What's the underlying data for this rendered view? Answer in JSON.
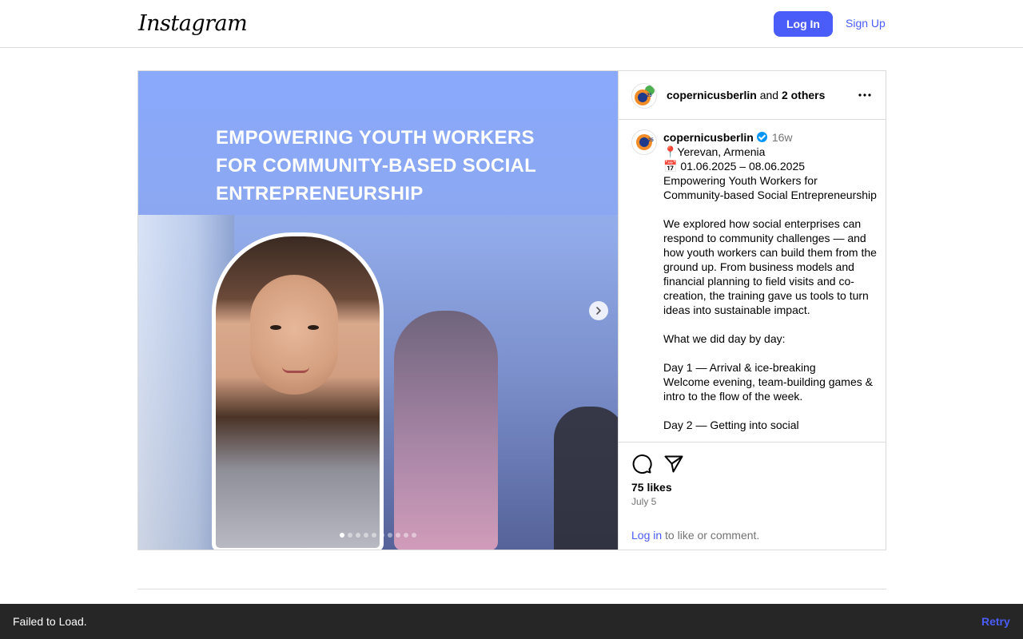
{
  "header": {
    "logo_text": "Instagram",
    "login_label": "Log In",
    "signup_label": "Sign Up"
  },
  "post": {
    "media": {
      "headline_lines": [
        "EMPOWERING YOUTH WORKERS",
        "FOR COMMUNITY-BASED SOCIAL",
        "ENTREPRENEURSHIP"
      ],
      "carousel_total": 10,
      "carousel_active": 1
    },
    "header": {
      "username": "copernicusberlin",
      "and_text": "and",
      "others": "2 others"
    },
    "caption": {
      "username": "copernicusberlin",
      "age": "16w",
      "text": "📍Yerevan, Armenia\n📅 01.06.2025 – 08.06.2025\nEmpowering Youth Workers for Community-based Social Entrepreneurship\n\nWe explored how social enterprises can respond to community challenges — and how youth workers can build them from the ground up. From business models and financial planning to field visits and co-creation, the training gave us tools to turn ideas into sustainable impact.\n\nWhat we did day by day:\n\nDay 1 — Arrival & ice-breaking\nWelcome evening, team-building games & intro to the flow of the week.\n\nDay 2 — Getting into social"
    },
    "likes": "75 likes",
    "date": "July 5",
    "login_link": "Log in",
    "login_rest": " to like or comment.",
    "avatar_tag": "25"
  },
  "toast": {
    "message": "Failed to Load.",
    "retry_label": "Retry"
  },
  "colors": {
    "accent": "#4a5df9",
    "verified": "#0095f6",
    "border": "#dbdbdb",
    "toast_bg": "#262626"
  },
  "icons": [
    "comment-icon",
    "share-icon",
    "more-icon",
    "chevron-right-icon",
    "verified-badge-icon"
  ]
}
